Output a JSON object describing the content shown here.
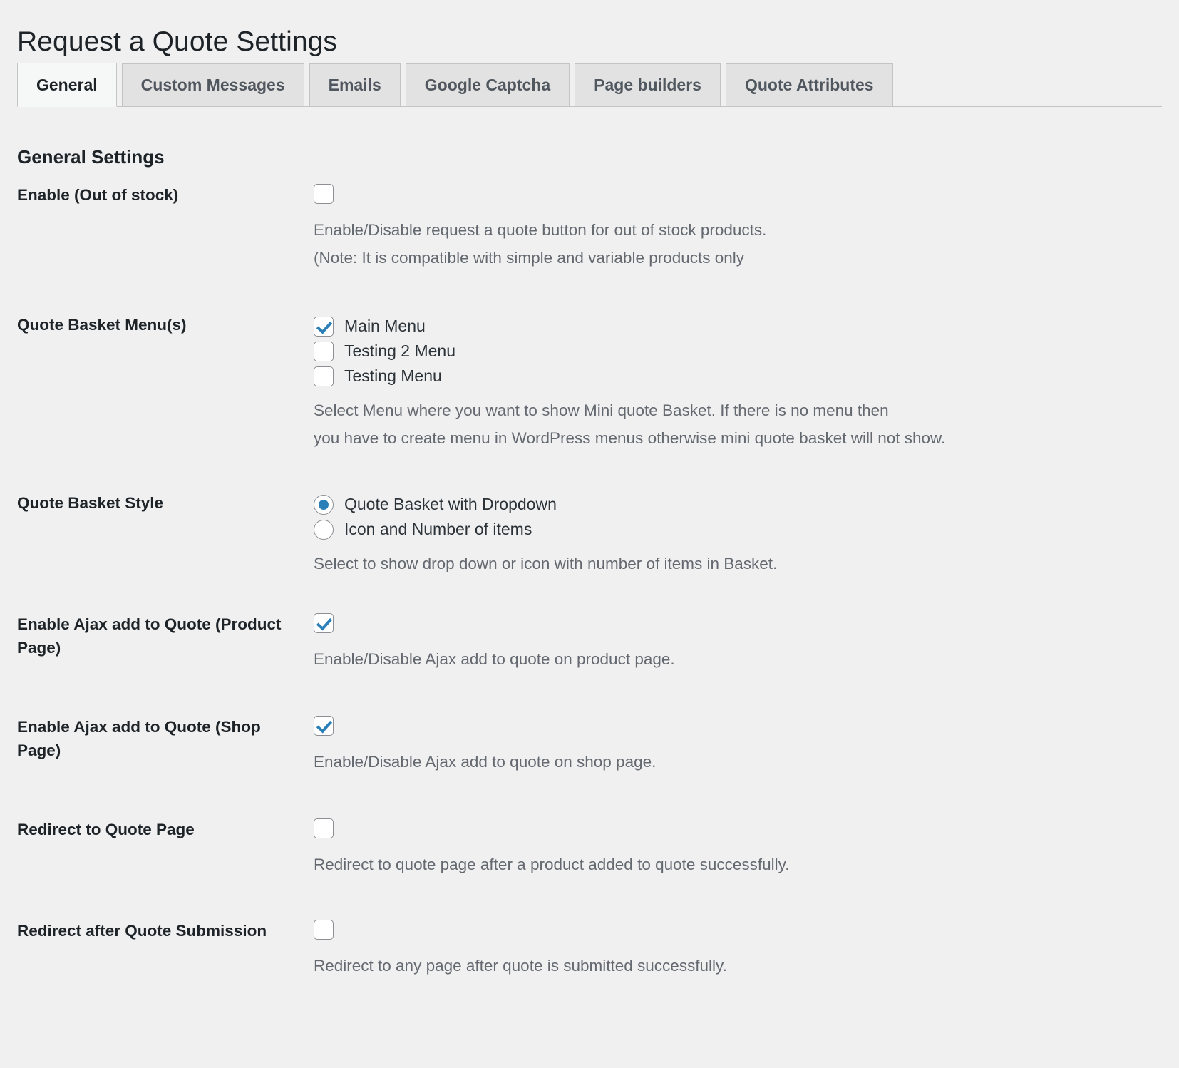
{
  "header": {
    "title": "Request a Quote Settings"
  },
  "tabs": [
    {
      "label": "General",
      "active": true
    },
    {
      "label": "Custom Messages",
      "active": false
    },
    {
      "label": "Emails",
      "active": false
    },
    {
      "label": "Google Captcha",
      "active": false
    },
    {
      "label": "Page builders",
      "active": false
    },
    {
      "label": "Quote Attributes",
      "active": false
    }
  ],
  "section": {
    "heading": "General Settings"
  },
  "settings": [
    {
      "key": "enable-out-of-stock",
      "label": "Enable (Out of stock)",
      "control": "checkbox",
      "checked": false,
      "description_lines": [
        "Enable/Disable request a quote button for out of stock products.",
        "(Note: It is compatible with simple and variable products only"
      ]
    },
    {
      "key": "quote-basket-menus",
      "label": "Quote Basket Menu(s)",
      "control": "checkbox-group",
      "options": [
        {
          "label": "Main Menu",
          "checked": true
        },
        {
          "label": "Testing 2 Menu",
          "checked": false
        },
        {
          "label": "Testing Menu",
          "checked": false
        }
      ],
      "description_lines": [
        "Select Menu where you want to show Mini quote Basket. If there is no menu then",
        "you have to create menu in WordPress menus otherwise mini quote basket will not show."
      ]
    },
    {
      "key": "quote-basket-style",
      "label": "Quote Basket Style",
      "control": "radio-group",
      "options": [
        {
          "label": "Quote Basket with Dropdown",
          "checked": true
        },
        {
          "label": "Icon and Number of items",
          "checked": false
        }
      ],
      "description_lines": [
        "Select to show drop down or icon with number of items in Basket."
      ]
    },
    {
      "key": "enable-ajax-product-page",
      "label": "Enable Ajax add to Quote (Product Page)",
      "control": "checkbox",
      "checked": true,
      "description_lines": [
        "Enable/Disable Ajax add to quote on product page."
      ]
    },
    {
      "key": "enable-ajax-shop-page",
      "label": "Enable Ajax add to Quote (Shop Page)",
      "control": "checkbox",
      "checked": true,
      "description_lines": [
        "Enable/Disable Ajax add to quote on shop page."
      ]
    },
    {
      "key": "redirect-to-quote-page",
      "label": "Redirect to Quote Page",
      "control": "checkbox",
      "checked": false,
      "description_lines": [
        "Redirect to quote page after a product added to quote successfully."
      ]
    },
    {
      "key": "redirect-after-quote-submission",
      "label": "Redirect after Quote Submission",
      "control": "checkbox",
      "checked": false,
      "description_lines": [
        "Redirect to any page after quote is submitted successfully."
      ]
    }
  ],
  "colors": {
    "background": "#f0f0f1",
    "accent": "#2a7fb8",
    "label_text": "#1d2327",
    "description_text": "#646970",
    "tab_inactive_bg": "#e2e2e2",
    "tab_active_bg": "#f6f7f7",
    "border": "#c3c4c7",
    "control_border": "#8c8f94"
  }
}
